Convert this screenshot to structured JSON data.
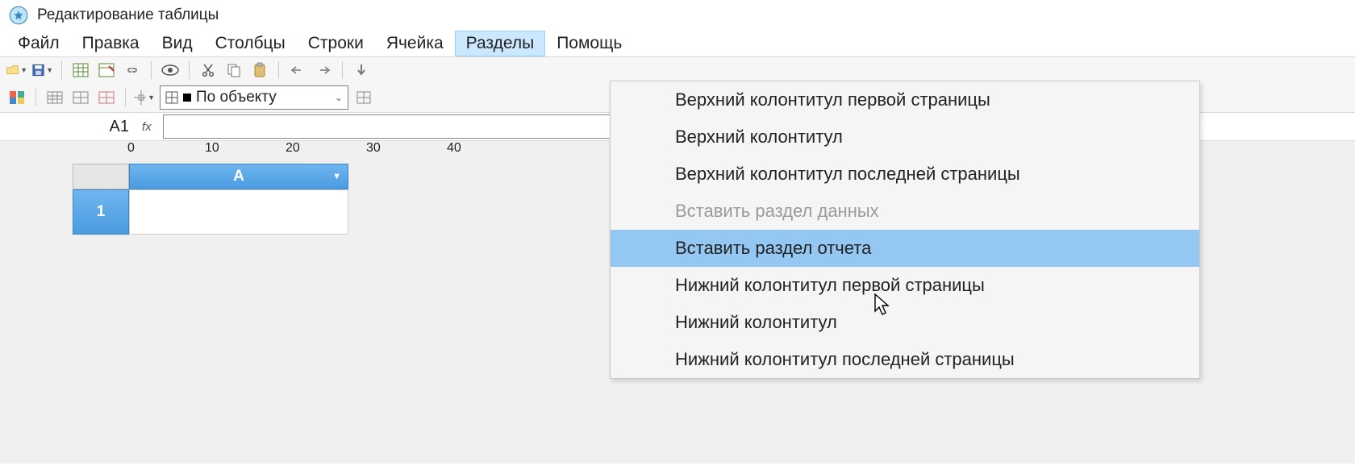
{
  "window": {
    "title": "Редактирование таблицы"
  },
  "menu": {
    "items": [
      "Файл",
      "Правка",
      "Вид",
      "Столбцы",
      "Строки",
      "Ячейка",
      "Разделы",
      "Помощь"
    ],
    "open_index": 6
  },
  "toolbar2": {
    "combo_label": "По объекту"
  },
  "formula": {
    "cell_name": "A1",
    "fx_label": "fx",
    "value": ""
  },
  "ruler": {
    "ticks": [
      "0",
      "10",
      "20",
      "30",
      "40"
    ]
  },
  "grid": {
    "col_header": "A",
    "row_header": "1"
  },
  "dropdown": {
    "items": [
      {
        "label": "Верхний колонтитул первой страницы",
        "disabled": false
      },
      {
        "label": "Верхний колонтитул",
        "disabled": false
      },
      {
        "label": "Верхний колонтитул последней страницы",
        "disabled": false
      },
      {
        "label": "Вставить раздел данных",
        "disabled": true
      },
      {
        "label": "Вставить раздел отчета",
        "disabled": false,
        "hover": true
      },
      {
        "label": "Нижний колонтитул первой страницы",
        "disabled": false
      },
      {
        "label": "Нижний колонтитул",
        "disabled": false
      },
      {
        "label": "Нижний колонтитул последней страницы",
        "disabled": false
      }
    ]
  }
}
